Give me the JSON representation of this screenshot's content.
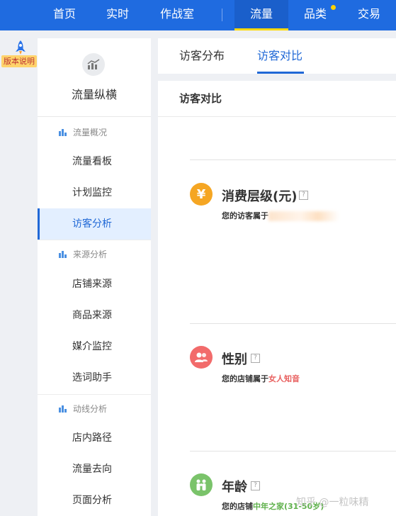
{
  "nav": {
    "items": [
      {
        "label": "首页"
      },
      {
        "label": "实时"
      },
      {
        "label": "作战室"
      },
      {
        "label": "流量"
      },
      {
        "label": "品类"
      },
      {
        "label": "交易"
      }
    ],
    "active_index": 3,
    "accent_color": "#ffd900",
    "bg_color": "#1f6be0"
  },
  "rail": {
    "icon": "rocket-icon",
    "label": "版本说明"
  },
  "sidebar": {
    "logo_icon": "trend-chart-icon",
    "title": "流量纵横",
    "groups": [
      {
        "label": "流量概况",
        "icon": "bar-chart-icon",
        "items": [
          {
            "label": "流量看板"
          },
          {
            "label": "计划监控"
          },
          {
            "label": "访客分析"
          }
        ]
      },
      {
        "label": "来源分析",
        "icon": "bar-chart-icon",
        "items": [
          {
            "label": "店铺来源"
          },
          {
            "label": "商品来源"
          },
          {
            "label": "媒介监控"
          },
          {
            "label": "选词助手"
          }
        ]
      },
      {
        "label": "动线分析",
        "icon": "bar-chart-icon",
        "items": [
          {
            "label": "店内路径"
          },
          {
            "label": "流量去向"
          },
          {
            "label": "页面分析"
          }
        ]
      }
    ],
    "active_item": "访客分析"
  },
  "tabs": [
    {
      "label": "访客分布"
    },
    {
      "label": "访客对比"
    }
  ],
  "panel": {
    "title": "访客对比",
    "metrics": [
      {
        "icon": "yen-icon",
        "icon_glyph": "¥",
        "color": "#f5a623",
        "title": "消费层级(元)",
        "desc_prefix": "您的访客属于",
        "highlight": "",
        "highlight_color": "#333333"
      },
      {
        "icon": "people-icon",
        "color": "#f26b6b",
        "title": "性别",
        "desc_prefix": "您的店铺属于",
        "highlight": "女人知音",
        "highlight_color": "#e8605f"
      },
      {
        "icon": "family-icon",
        "color": "#7ac36a",
        "title": "年龄",
        "desc_prefix": "您的店铺",
        "highlight": "中年之家(31-50岁)",
        "highlight_color": "#5fb14c"
      }
    ],
    "help_glyph": "?"
  },
  "watermark": "知乎 @一粒味精"
}
